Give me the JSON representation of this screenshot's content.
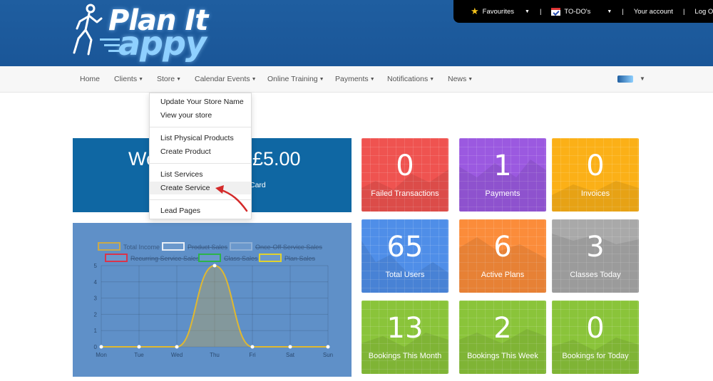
{
  "header": {
    "logo_line1": "Plan It",
    "logo_line2": "appy",
    "top_menu": {
      "favourites": "Favourites",
      "todos": "TO-DO's",
      "account": "Your account",
      "logout": "Log Out"
    }
  },
  "nav": {
    "items": [
      {
        "label": "Home",
        "dropdown": false
      },
      {
        "label": "Clients",
        "dropdown": true
      },
      {
        "label": "Store",
        "dropdown": true
      },
      {
        "label": "Calendar Events",
        "dropdown": true
      },
      {
        "label": "Online Training",
        "dropdown": true
      },
      {
        "label": "Payments",
        "dropdown": true
      },
      {
        "label": "Notifications",
        "dropdown": true
      },
      {
        "label": "News",
        "dropdown": true
      }
    ]
  },
  "store_menu": {
    "items": [
      "Update Your Store Name",
      "View your store",
      "List Physical Products",
      "Create Product",
      "List Services",
      "Create Service",
      "Lead Pages"
    ],
    "highlighted": "Create Service"
  },
  "welcome": {
    "title_fragment": "We",
    "amount_fragment": "£5.00",
    "caption_fragment": "Card"
  },
  "chart_data": {
    "type": "line",
    "categories": [
      "Mon",
      "Tue",
      "Wed",
      "Thu",
      "Fri",
      "Sat",
      "Sun"
    ],
    "ylim": [
      0,
      5
    ],
    "yticks": [
      "0",
      "1",
      "2",
      "3",
      "4",
      "5"
    ],
    "series": [
      {
        "name": "Total Income",
        "values": [
          0,
          0,
          0,
          5,
          0,
          0,
          0
        ],
        "color": "#c9a94a",
        "hidden": false
      },
      {
        "name": "Product Sales",
        "values": [
          0,
          0,
          0,
          0,
          0,
          0,
          0
        ],
        "color": "#e8eef6",
        "hidden": true
      },
      {
        "name": "Once-Off Service Sales",
        "values": [
          0,
          0,
          0,
          0,
          0,
          0,
          0
        ],
        "color": "#8fb0d6",
        "hidden": true
      },
      {
        "name": "Recurring Service Sales",
        "values": [
          0,
          0,
          0,
          0,
          0,
          0,
          0
        ],
        "color": "#d9344b",
        "hidden": true
      },
      {
        "name": "Class Sales",
        "values": [
          0,
          0,
          0,
          0,
          0,
          0,
          0
        ],
        "color": "#2db34a",
        "hidden": true
      },
      {
        "name": "Plan Sales",
        "values": [
          0,
          0,
          0,
          0,
          0,
          0,
          0
        ],
        "color": "#e1d22e",
        "hidden": true
      }
    ],
    "legend": "top"
  },
  "tiles": [
    {
      "value": "0",
      "label": "Failed Transactions",
      "color": "#ef5350"
    },
    {
      "value": "1",
      "label": "Payments",
      "color": "#9b59e0"
    },
    {
      "value": "0",
      "label": "Invoices",
      "color": "#fbb017"
    },
    {
      "value": "65",
      "label": "Total Users",
      "color": "#4f8ee8"
    },
    {
      "value": "6",
      "label": "Active Plans",
      "color": "#fb8c3a"
    },
    {
      "value": "3",
      "label": "Classes Today",
      "color": "#a9a9a9"
    },
    {
      "value": "13",
      "label": "Bookings This Month",
      "color": "#8ac43a"
    },
    {
      "value": "2",
      "label": "Bookings This Week",
      "color": "#8ac43a"
    },
    {
      "value": "0",
      "label": "Bookings for Today",
      "color": "#8ac43a"
    }
  ]
}
